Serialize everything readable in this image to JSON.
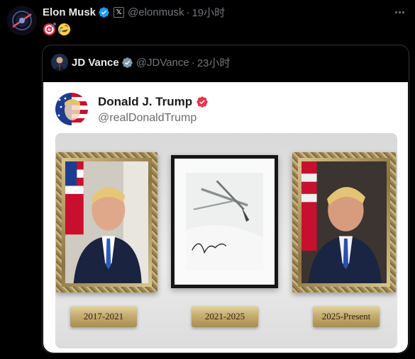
{
  "post": {
    "author_name": "Elon Musk",
    "handle": "@elonmusk",
    "separator": "·",
    "time": "19小时",
    "affiliation_badge": "𝕏",
    "emojis": [
      "direct-hit-emoji",
      "rolling-on-floor-laughing-emoji"
    ]
  },
  "quote": {
    "author_name": "JD Vance",
    "handle": "@JDVance",
    "separator": "·",
    "time": "23小时",
    "card": {
      "name": "Donald J. Trump",
      "handle": "@realDonaldTrump",
      "plaques": [
        "2017-2021",
        "2021-2025",
        "2025-Present"
      ]
    }
  },
  "colors": {
    "background": "#000000",
    "text_primary": "#e7e9ea",
    "text_secondary": "#71767b",
    "verified_blue": "#1d9bf0",
    "verified_gray": "#829aab",
    "truth_badge": "#e5344d",
    "border": "#2f3336"
  }
}
